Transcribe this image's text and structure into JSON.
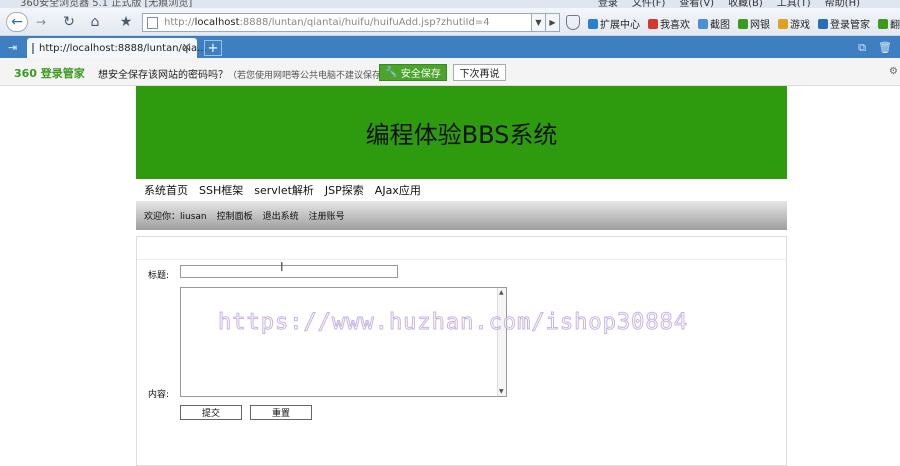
{
  "browser": {
    "title": "360安全浏览器 5.1 正式版 [无痕浏览]",
    "menu": [
      "登录",
      "文件(F)",
      "查看(V)",
      "收藏(B)",
      "工具(T)",
      "帮助(H)"
    ],
    "address": {
      "prefix": "http://",
      "host": "localhost",
      "path": ":8888/luntan/qiantai/huifu/huifuAdd.jsp?zhutiId=4"
    },
    "extensions": [
      {
        "label": "扩展中心",
        "color": "#2a7fd4"
      },
      {
        "label": "我喜欢",
        "color": "#d43a2a"
      },
      {
        "label": "截图",
        "color": "#4a90d9"
      },
      {
        "label": "网银",
        "color": "#3a9a1e"
      },
      {
        "label": "游戏",
        "color": "#e0a020"
      },
      {
        "label": "登录管家",
        "color": "#2a6fb5"
      },
      {
        "label": "翻",
        "color": "#3a9a1e"
      }
    ],
    "tab": {
      "label": "http://localhost:8888/luntan/qia..."
    },
    "password_bar": {
      "brand": "360 登录管家",
      "message": "想安全保存该网站的密码吗？",
      "hint": "（若您使用网吧等公共电脑不建议保存）",
      "save_label": "安全保存",
      "later_label": "下次再说"
    }
  },
  "site": {
    "title": "编程体验BBS系统",
    "nav": [
      "系统首页",
      "SSH框架",
      "servlet解析",
      "JSP探索",
      "AJax应用"
    ],
    "user_nav": [
      "欢迎你：liusan",
      "控制面板",
      "退出系统",
      "注册账号"
    ]
  },
  "form": {
    "title_label": "标题:",
    "content_label": "内容:",
    "submit_label": "提交",
    "reset_label": "重置"
  },
  "watermark": "https://www.huzhan.com/ishop30884"
}
